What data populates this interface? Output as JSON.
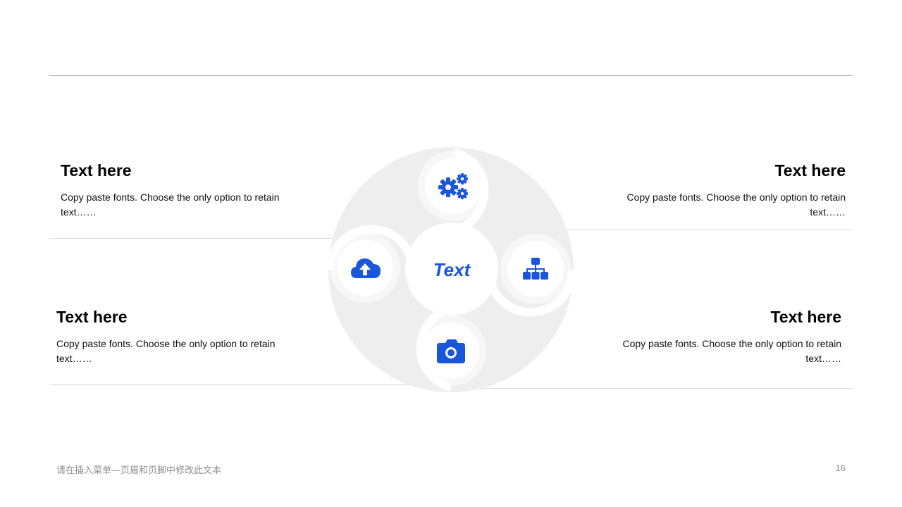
{
  "blocks": [
    {
      "title": "Text here",
      "body": "Copy paste fonts. Choose the only option to retain text……"
    },
    {
      "title": "Text here",
      "body": "Copy paste fonts. Choose the only option to retain text……"
    },
    {
      "title": "Text here",
      "body": "Copy paste fonts. Choose the only option to retain text……"
    },
    {
      "title": "Text here",
      "body": "Copy paste fonts. Choose the only option to retain text……"
    }
  ],
  "diagram": {
    "center_label": "Text",
    "icons": [
      "gears-icon",
      "org-chart-icon",
      "camera-icon",
      "cloud-upload-icon"
    ],
    "accent_color": "#1a56db",
    "petal_color": "#eeeeee"
  },
  "footer": {
    "text": "请在插入菜单—页眉和页脚中修改此文本",
    "page_number": "16"
  }
}
